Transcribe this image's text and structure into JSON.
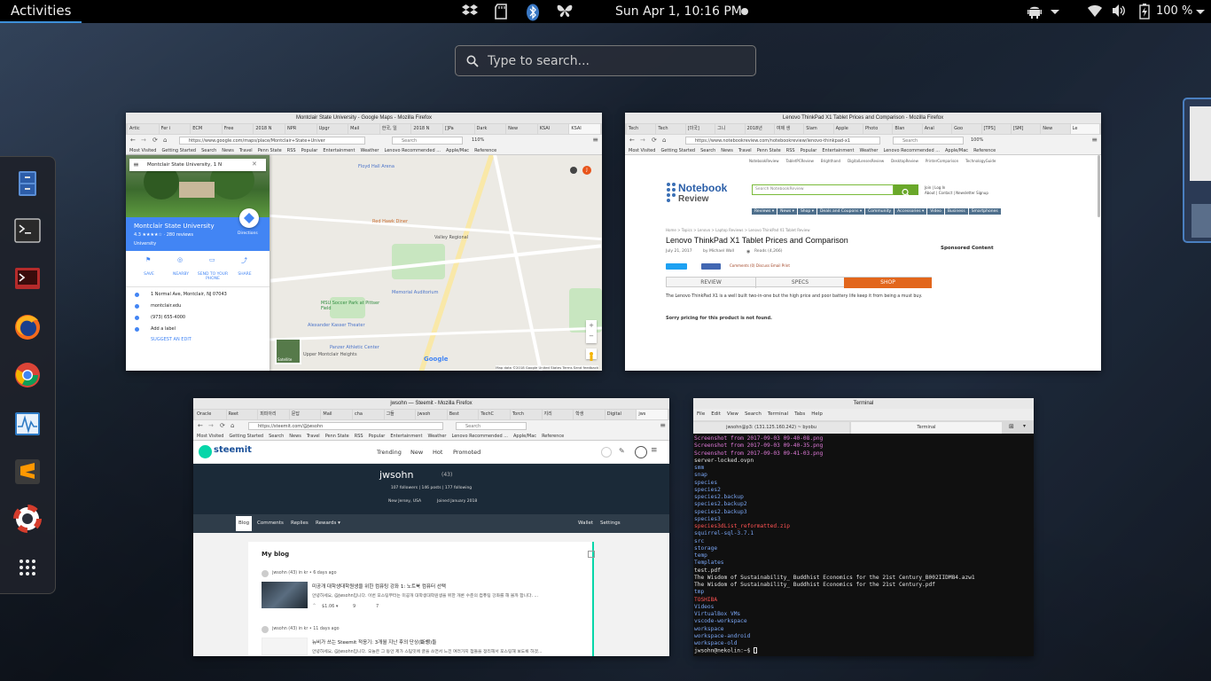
{
  "topbar": {
    "activities": "Activities",
    "clock": "Sun Apr  1, 10:16 PM",
    "battery": "100 %"
  },
  "search": {
    "placeholder": "Type to search..."
  },
  "dash": {
    "apps": [
      "file-cabinet-icon",
      "terminal-icon",
      "system-monitor-red-icon",
      "firefox-icon",
      "chrome-icon",
      "activity-monitor-icon",
      "sublime-text-icon",
      "help-lifebuoy-icon",
      "show-apps-grid-icon"
    ]
  },
  "windows": {
    "maps": {
      "title": "Montclair State University - Google Maps - Mozilla Firefox",
      "tabs": [
        "Artic",
        "Fer i",
        "ECM",
        "Free",
        "2018 N",
        "NPR",
        "Upgr",
        "Mail",
        "한국, 일",
        "2018 N",
        "[]Pa",
        "Dark",
        "New",
        "KSAI",
        "KSAI"
      ],
      "url": "https://www.google.com/maps/place/Montclair+State+Univer",
      "zoom": "110%",
      "search_placeholder": "Search",
      "bookmarks": [
        "Most Visited",
        "Getting Started",
        "Search",
        "News",
        "Travel",
        "Penn State",
        "RSS",
        "Popular",
        "Entertainment",
        "Weather",
        "Lenovo Recommended ...",
        "Apple/Mac",
        "Reference"
      ],
      "panel": {
        "search_value": "Montclair State University, 1 N",
        "place_name": "Montclair State University",
        "rating": "4.3 ★★★★☆ · 280 reviews",
        "category": "University",
        "directions": "Directions",
        "actions": [
          "SAVE",
          "NEARBY",
          "SEND TO YOUR PHONE",
          "SHARE"
        ],
        "address": "1 Normal Ave, Montclair, NJ 07043",
        "website": "montclair.edu",
        "phone": "(973) 655-4000",
        "add_label": "Add a label",
        "suggest_edit": "SUGGEST AN EDIT"
      },
      "map_labels": [
        "Floyd Hall Arena",
        "Red Hawk Diner",
        "Valley Regional",
        "Memorial Auditorium",
        "MSU Soccer Park at Pittser Field",
        "Alexander Kasser Theater",
        "Panzer Athletic Center",
        "Upper Montclair Heights"
      ],
      "satellite_label": "Satellite",
      "footer": "Map data ©2018 Google  United States  Terms  Send feedback",
      "google": "Google"
    },
    "notebook": {
      "title": "Lenovo ThinkPad X1 Tablet Prices and Comparison - Mozilla Firefox",
      "tabs": [
        "Tech",
        "Tech",
        "[미국]",
        "그니",
        "2018년",
        "여제 생",
        "Slam",
        "Apple",
        "Photo",
        "Blan",
        "Anal",
        "Goo",
        "[TPS]",
        "[SM]",
        "New",
        "Le"
      ],
      "url": "https://www.notebookreview.com/notebookreview/lenovo-thinkpad-x1",
      "zoom": "100%",
      "search_placeholder": "Search",
      "bookmarks": [
        "Most Visited",
        "Getting Started",
        "Search",
        "News",
        "Travel",
        "Penn State",
        "RSS",
        "Popular",
        "Entertainment",
        "Weather",
        "Lenovo Recommended ...",
        "Apple/Mac",
        "Reference"
      ],
      "top_links": [
        "NotebookReview",
        "TabletPCReview",
        "Brighthand",
        "DigitalLensesReview",
        "DesktopReview",
        "PrinterComparison",
        "TechnologyGuide"
      ],
      "logo_line1": "Notebook",
      "logo_line2": "Review",
      "nav": [
        "Reviews ▾",
        "News ▾",
        "Shop ▾",
        "Deals and Coupons ▾",
        "Community",
        "Accessories ▾",
        "Video",
        "Business",
        "Smartphones"
      ],
      "headline": "Lenovo ThinkPad X1 Tablet Prices and Comparison",
      "date": "July 21, 2017",
      "author": "by Michael Wall",
      "reads": "Reads (4,266)",
      "sponsored": "Sponsored Content",
      "tabs_row": [
        "REVIEW",
        "SPECS",
        "SHOP"
      ],
      "body": "The Lenovo ThinkPad X1 is a well built two-in-one but the high price and poor battery life keep it from being a must buy.",
      "sorry": "Sorry pricing for this product is not found."
    },
    "steemit": {
      "title": "jwsohn — Steemit - Mozilla Firefox",
      "tabs": [
        "Oracle",
        "Reet",
        "피피아리",
        "문답",
        "Mail",
        "cha",
        "그들",
        "jwsoh",
        "Best",
        "TechC",
        "Torch",
        "지리",
        "학생",
        "Digital",
        "jws"
      ],
      "url": "https://steemit.com/@jwsohn",
      "search_placeholder": "Search",
      "bookmarks": [
        "Most Visited",
        "Getting Started",
        "Search",
        "News",
        "Travel",
        "Penn State",
        "RSS",
        "Popular",
        "Entertainment",
        "Weather",
        "Lenovo Recommended ...",
        "Apple/Mac",
        "Reference"
      ],
      "logo": "steemit",
      "nav": [
        "Trending",
        "New",
        "Hot",
        "Promoted"
      ],
      "username": "jwsohn",
      "rep": "(43)",
      "stats": "107 followers  |  146 posts  |  177 following",
      "location": "New Jersey, USA",
      "joined": "Joined January 2018",
      "profile_tabs": [
        "Blog",
        "Comments",
        "Replies",
        "Rewards ▾"
      ],
      "right_tabs": [
        "Wallet",
        "Settings"
      ],
      "my_blog": "My blog",
      "post1_meta": "jwsohn (43) in kr • 6 days ago",
      "post1_title": "미공개 대학생대학원생을 위한 컴퓨팅 강좌 1: 노트북 컴퓨터 선택",
      "post1_excerpt": "안녕하세요, @jwsohn입니다. 이번 포스팅부터는 미공개 대학생대학원생을 위한 개론 수준의 컴퓨팅 강좌를 해 볼까 합니다. ...",
      "post1_value": "$1.06 ▾",
      "post1_votes": "9",
      "post1_comments": "7",
      "post2_meta": "jwsohn (43) in kr • 11 days ago",
      "post2_title": "뉴비가 쓰는 Steemit 적응기: 3개월 지난 후의 단상(斷想)들",
      "post2_excerpt": "안녕하세요, @jwsohn입니다. 오늘은 그 동안 제가 스팀잇에 글을 쓰면서 느낀 여러가지 점들을 정리해서 포스팅해 보도록 하겠..."
    },
    "terminal": {
      "title": "Terminal",
      "menu": [
        "File",
        "Edit",
        "View",
        "Search",
        "Terminal",
        "Tabs",
        "Help"
      ],
      "tab1": "jwsohn@p3: (131.125.160.242) ~ byobu",
      "tab2": "Terminal",
      "prompt": "jwsohn@nekolin:~$ ",
      "lines": [
        {
          "text": "Screenshot from 2017-09-03 09-40-08.png",
          "color": "#e27bdb"
        },
        {
          "text": "Screenshot from 2017-09-03 09-40-35.png",
          "color": "#e27bdb"
        },
        {
          "text": "Screenshot from 2017-09-03 09-41-03.png",
          "color": "#e27bdb"
        },
        {
          "text": "server-locked.ovpn",
          "color": "#e6e6e6"
        },
        {
          "text": "smm",
          "color": "#7aa6f5"
        },
        {
          "text": "snap",
          "color": "#7aa6f5"
        },
        {
          "text": "species",
          "color": "#7aa6f5"
        },
        {
          "text": "species2",
          "color": "#7aa6f5"
        },
        {
          "text": "species2.backup",
          "color": "#7aa6f5"
        },
        {
          "text": "species2.backup2",
          "color": "#7aa6f5"
        },
        {
          "text": "species2.backup3",
          "color": "#7aa6f5"
        },
        {
          "text": "species3",
          "color": "#7aa6f5"
        },
        {
          "text": "species3dList_reformatted.zip",
          "color": "#ff5252"
        },
        {
          "text": "squirrel-sql-3.7.1",
          "color": "#7aa6f5"
        },
        {
          "text": "src",
          "color": "#7aa6f5"
        },
        {
          "text": "storage",
          "color": "#7aa6f5"
        },
        {
          "text": "temp",
          "color": "#7aa6f5"
        },
        {
          "text": "Templates",
          "color": "#7aa6f5"
        },
        {
          "text": "test.pdf",
          "color": "#e6e6e6"
        },
        {
          "text": "The Wisdom of Sustainability_ Buddhist Economics for the 21st Century_B002IIDM84.azw1",
          "color": "#e6e6e6"
        },
        {
          "text": "The Wisdom of Sustainability_ Buddhist Economics for the 21st Century.pdf",
          "color": "#e6e6e6"
        },
        {
          "text": "tmp",
          "color": "#7aa6f5"
        },
        {
          "text": "TOSHIBA",
          "color": "#ff5252"
        },
        {
          "text": "Videos",
          "color": "#7aa6f5"
        },
        {
          "text": "VirtualBox VMs",
          "color": "#7aa6f5"
        },
        {
          "text": "vscode-workspace",
          "color": "#7aa6f5"
        },
        {
          "text": "workspace",
          "color": "#7aa6f5"
        },
        {
          "text": "workspace-android",
          "color": "#7aa6f5"
        },
        {
          "text": "workspace-old",
          "color": "#7aa6f5"
        }
      ]
    }
  }
}
